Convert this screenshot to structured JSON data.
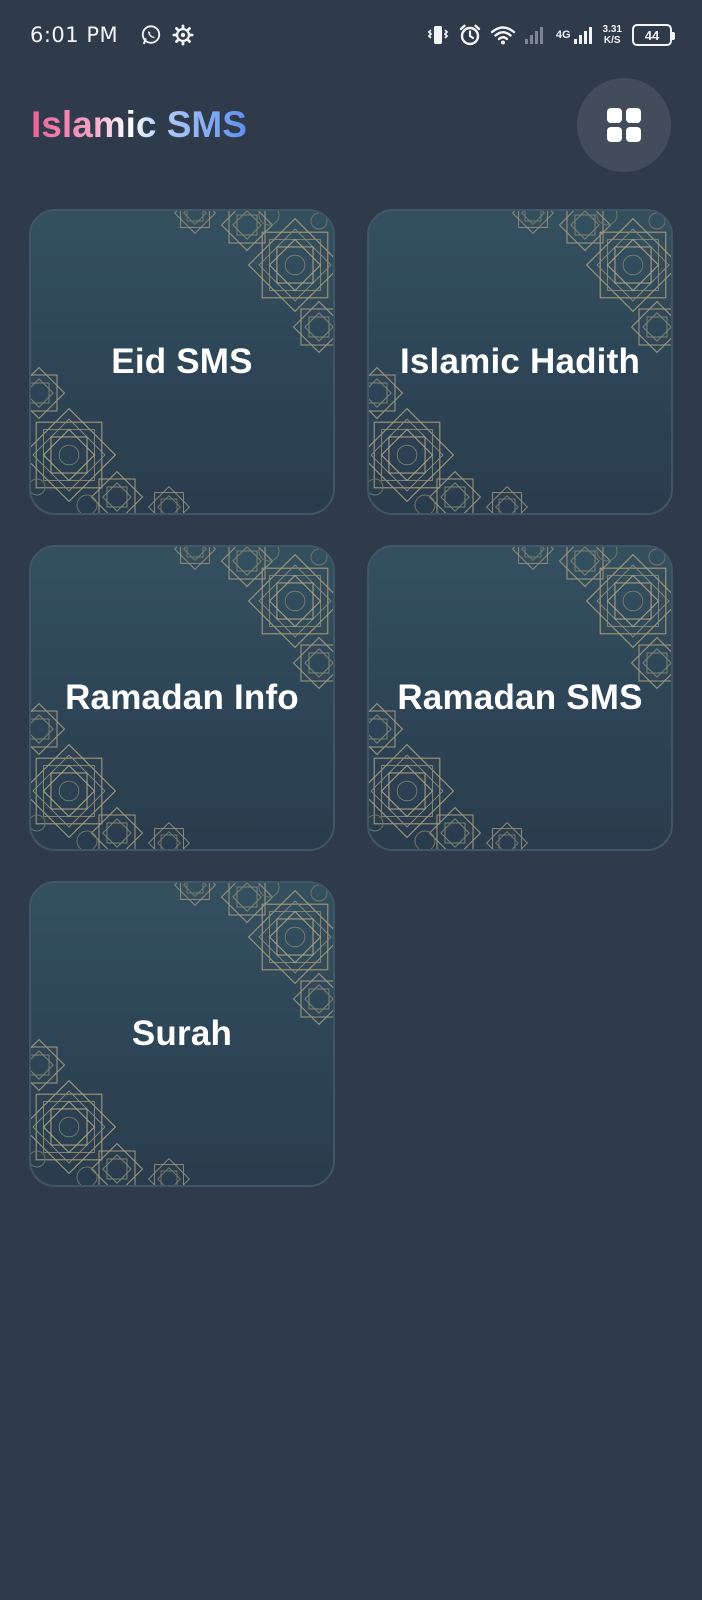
{
  "status_bar": {
    "time": "6:01 PM",
    "left_icons": [
      "whatsapp-icon",
      "gear-icon"
    ],
    "right_icons": [
      "vibrate-icon",
      "alarm-icon",
      "wifi-icon",
      "signal-icon"
    ],
    "network": "4G",
    "speed_value": "3.31",
    "speed_unit": "K/S",
    "battery": "44"
  },
  "header": {
    "title": "Islamic SMS",
    "menu_icon": "grid-icon"
  },
  "colors": {
    "background": "#2f3a4b",
    "card_top": "#34505f",
    "card_bottom": "#293c4d",
    "title_gradient_start": "#ef5f95",
    "title_gradient_end": "#5e8ff0",
    "menu_button_bg": "#434c5b"
  },
  "categories": [
    {
      "label": "Eid SMS"
    },
    {
      "label": "Islamic Hadith"
    },
    {
      "label": "Ramadan Info"
    },
    {
      "label": "Ramadan SMS"
    },
    {
      "label": "Surah"
    }
  ]
}
